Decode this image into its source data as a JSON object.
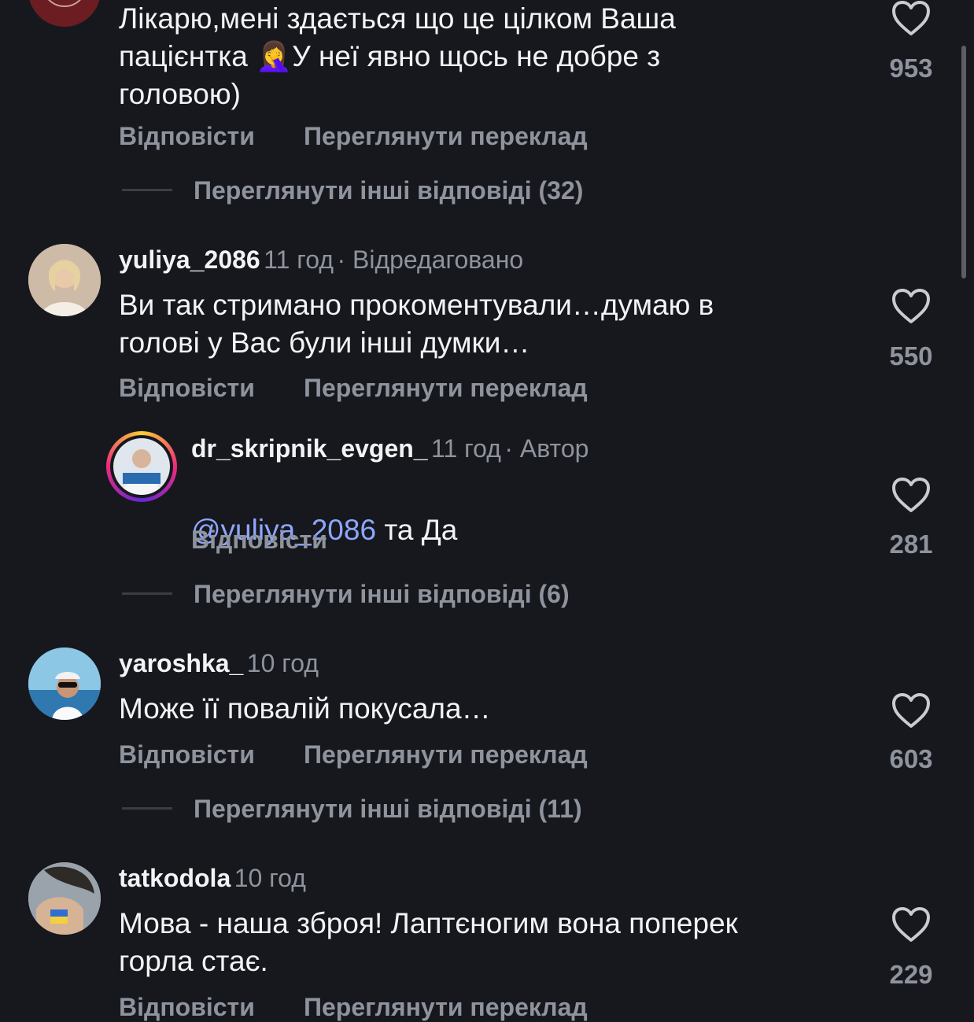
{
  "comments": [
    {
      "text": "Лікарю,мені здається що це цілком Ваша\nпацієнтка 🤦‍♀️У неї явно щось не добре з\nголовою)",
      "likes": "953",
      "reply_label": "Відповісти",
      "translate_label": "Переглянути переклад",
      "more_replies": "Переглянути інші відповіді (32)"
    },
    {
      "username": "yuliya_2086",
      "time": "11 год",
      "edited": "· Відредаговано",
      "text": "Ви так стримано прокоментували…думаю в\nголові у Вас були інші думки…",
      "likes": "550",
      "reply_label": "Відповісти",
      "translate_label": "Переглянути переклад"
    },
    {
      "username": "dr_skripnik_evgen_",
      "time": "11 год",
      "author_badge": "· Автор",
      "mention": "@yuliya_2086",
      "text": " та Да",
      "likes": "281",
      "reply_label": "Відповісти",
      "more_replies": "Переглянути інші відповіді (6)"
    },
    {
      "username": "yaroshka_",
      "time": "10 год",
      "text": "Може її повалій покусала…",
      "likes": "603",
      "reply_label": "Відповісти",
      "translate_label": "Переглянути переклад",
      "more_replies": "Переглянути інші відповіді (11)"
    },
    {
      "username": "tatkodola",
      "time": "10 год",
      "text": "Мова - наша зброя! Лаптєногим вона поперек\nгорла стає.",
      "likes": "229",
      "reply_label": "Відповісти",
      "translate_label": "Переглянути переклад"
    }
  ],
  "icons": {
    "like": "heart-outline-icon"
  },
  "colors": {
    "background": "#16181d",
    "muted": "#8e939d",
    "mention": "#8ea6ff"
  }
}
